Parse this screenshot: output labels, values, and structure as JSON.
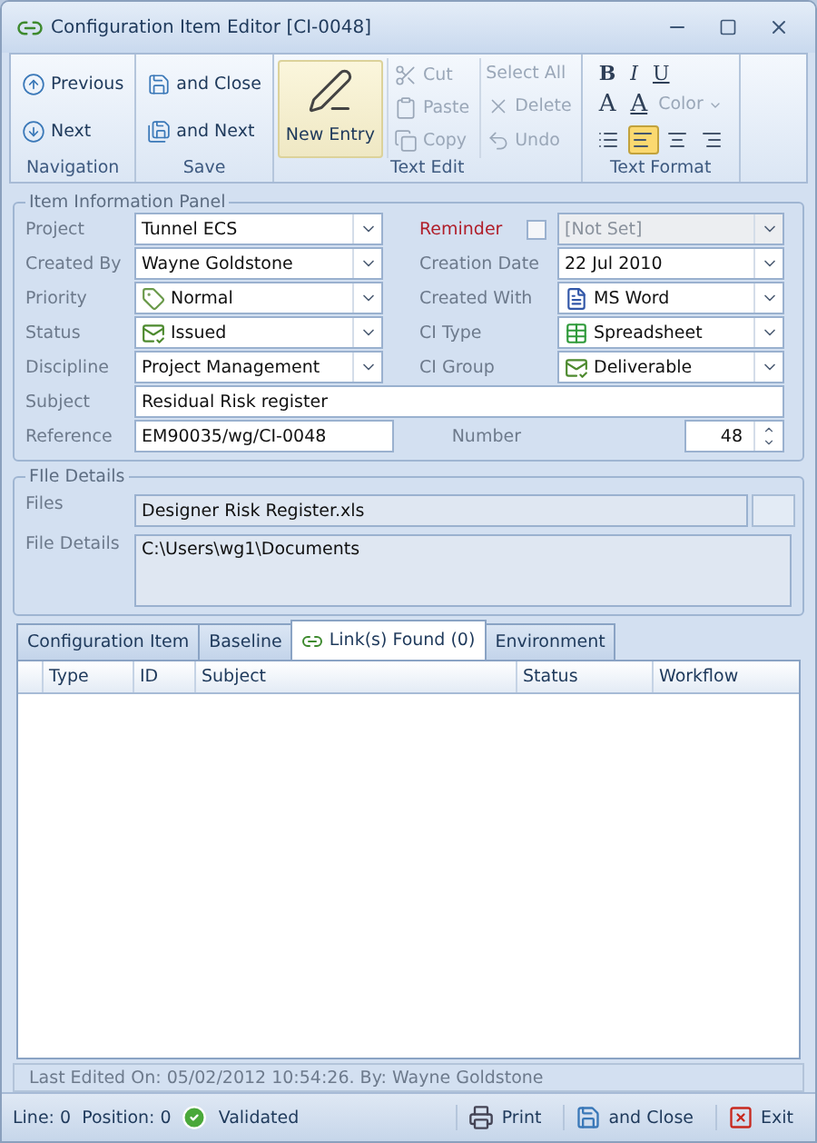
{
  "window": {
    "title": "Configuration Item Editor [CI-0048]"
  },
  "ribbon": {
    "groups": [
      {
        "kind": "stack",
        "label": "Navigation",
        "buttons": [
          {
            "label": "Previous",
            "disabled": false
          },
          {
            "label": "Next",
            "disabled": false
          }
        ]
      },
      {
        "kind": "stack",
        "label": "Save",
        "buttons": [
          {
            "label": "and Close",
            "disabled": false
          },
          {
            "label": "and Next",
            "disabled": false
          }
        ]
      },
      {
        "kind": "edit",
        "label": "Text Edit",
        "large": {
          "label": "New Entry"
        },
        "columns": [
          [
            {
              "label": "Cut",
              "disabled": true
            },
            {
              "label": "Paste",
              "disabled": true
            },
            {
              "label": "Copy",
              "disabled": true
            }
          ],
          [
            {
              "label": "Select All",
              "disabled": true
            },
            {
              "label": "Delete",
              "disabled": true
            },
            {
              "label": "Undo",
              "disabled": true
            }
          ]
        ]
      },
      {
        "kind": "format",
        "label": "Text Format",
        "styles": [
          "B",
          "I",
          "U"
        ],
        "letters": [
          "A",
          "A"
        ],
        "color": {
          "label": "Color",
          "disabled": true
        },
        "aligns": [
          {
            "selected": false
          },
          {
            "selected": true
          },
          {
            "selected": false
          },
          {
            "selected": false
          }
        ]
      }
    ]
  },
  "item_panel": {
    "title": "Item Information Panel",
    "rows": [
      {
        "left": {
          "label": "Project",
          "value": "Tunnel ECS",
          "kind": "combo"
        },
        "right": {
          "label": "Reminder",
          "highlight": true,
          "checkbox": {
            "checked": false
          },
          "value": "[Not Set]",
          "kind": "combo",
          "disabled": true
        }
      },
      {
        "left": {
          "label": "Created By",
          "value": "Wayne Goldstone",
          "kind": "combo"
        },
        "right": {
          "label": "Creation Date",
          "value": "22 Jul 2010",
          "kind": "combo"
        }
      },
      {
        "left": {
          "label": "Priority",
          "value": "Normal",
          "kind": "icon_combo"
        },
        "right": {
          "label": "Created With",
          "value": "MS Word",
          "kind": "icon_combo"
        }
      },
      {
        "left": {
          "label": "Status",
          "value": "Issued",
          "kind": "icon_combo"
        },
        "right": {
          "label": "CI Type",
          "value": "Spreadsheet",
          "kind": "icon_combo"
        }
      },
      {
        "left": {
          "label": "Discipline",
          "value": "Project Management",
          "kind": "combo"
        },
        "right": {
          "label": "CI Group",
          "value": "Deliverable",
          "kind": "icon_combo"
        }
      },
      {
        "full": {
          "label": "Subject",
          "value": "Residual Risk register",
          "kind": "text"
        }
      },
      {
        "left": {
          "label": "Reference",
          "value": "EM90035/wg/CI-0048",
          "kind": "text"
        },
        "right": {
          "label": "Number",
          "value": "48",
          "kind": "spin"
        }
      }
    ]
  },
  "file_panel": {
    "title": "FIle Details",
    "files": {
      "label": "Files",
      "value": "Designer Risk Register.xls"
    },
    "details": {
      "label": "File Details",
      "value": "C:\\Users\\wg1\\Documents"
    }
  },
  "tabs": [
    {
      "label": "Configuration Item",
      "selected": false
    },
    {
      "label": "Baseline",
      "selected": false
    },
    {
      "label": "Link(s) Found (0)",
      "selected": true
    },
    {
      "label": "Environment",
      "selected": false
    }
  ],
  "grid": {
    "columns": [
      "Type",
      "ID",
      "Subject",
      "Status",
      "Workflow"
    ]
  },
  "last_edited": "Last Edited On: 05/02/2012 10:54:26. By: Wayne Goldstone",
  "status_bar": {
    "line": "Line: 0",
    "position": "Position: 0",
    "validation": "Validated",
    "buttons": [
      {
        "label": "Print"
      },
      {
        "label": "and Close"
      },
      {
        "label": "Exit"
      }
    ]
  }
}
